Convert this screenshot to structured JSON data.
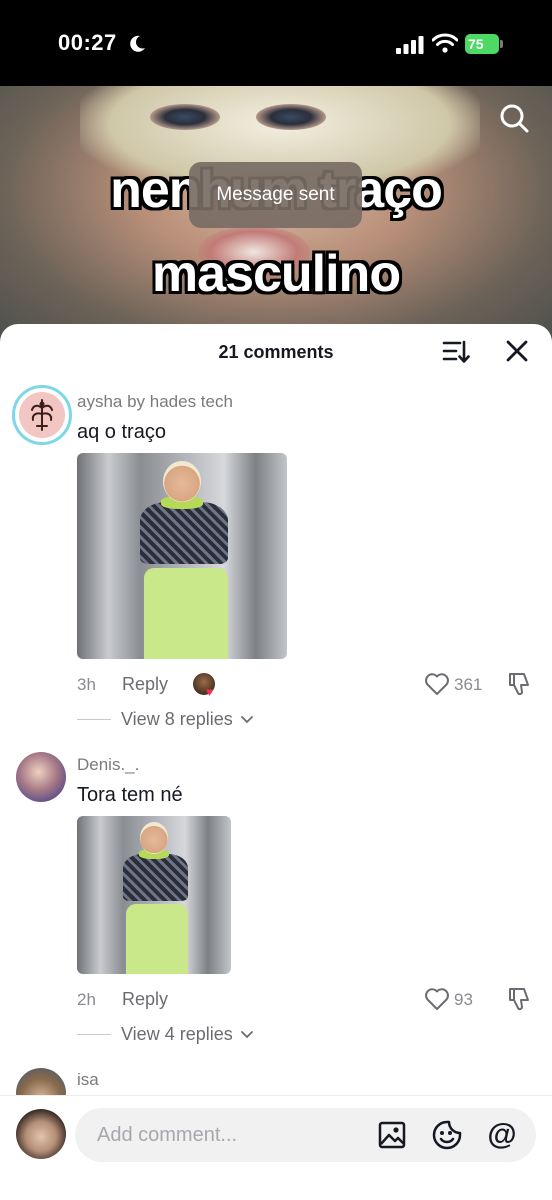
{
  "status_bar": {
    "time": "00:27",
    "battery": "75"
  },
  "video": {
    "caption_line_1": "nenhum traço",
    "caption_line_2": "masculino",
    "toast": "Message sent"
  },
  "comments_panel": {
    "title": "21 comments",
    "comments": [
      {
        "username": "aysha by hades tech",
        "text": "aq o traço",
        "time": "3h",
        "reply_label": "Reply",
        "likes": "361",
        "view_replies": "View 8 replies"
      },
      {
        "username": "Denis._.",
        "text": "Tora tem né",
        "time": "2h",
        "reply_label": "Reply",
        "likes": "93",
        "view_replies": "View 4 replies"
      },
      {
        "username": "isa"
      }
    ]
  },
  "composer": {
    "placeholder": "Add comment..."
  },
  "colors": {
    "accent_heart": "#fe2c55",
    "battery": "#4cd964"
  }
}
